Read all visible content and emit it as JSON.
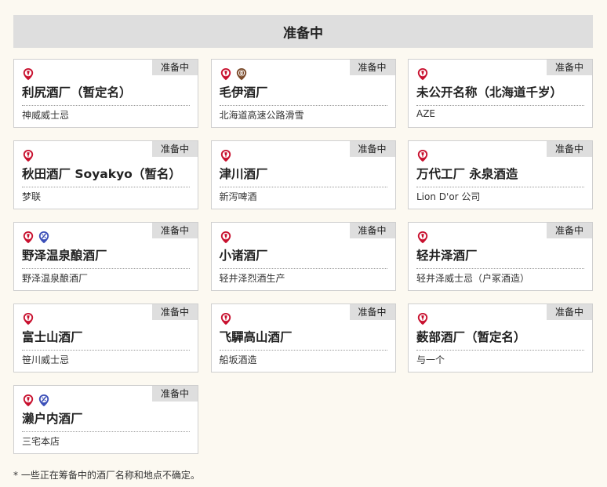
{
  "header": {
    "title": "准备中"
  },
  "cards": [
    {
      "status": "准备中",
      "name": "利尻酒厂（暂定名）",
      "brand": "神威威士忌",
      "icons": [
        "distillery-pin"
      ]
    },
    {
      "status": "准备中",
      "name": "毛伊酒厂",
      "brand": "北海道高速公路滑雪",
      "icons": [
        "distillery-pin",
        "barrel-pin"
      ]
    },
    {
      "status": "准备中",
      "name": "未公开名称（北海道千岁）",
      "brand": "AZE",
      "icons": [
        "distillery-pin"
      ]
    },
    {
      "status": "准备中",
      "name": "秋田酒厂 Soyakyo（暂名）",
      "brand": "梦联",
      "icons": [
        "distillery-pin"
      ]
    },
    {
      "status": "准备中",
      "name": "津川酒厂",
      "brand": "新泻啤酒",
      "icons": [
        "distillery-pin"
      ]
    },
    {
      "status": "准备中",
      "name": "万代工厂 永泉酒造",
      "brand": "Lion D'or 公司",
      "icons": [
        "distillery-pin"
      ]
    },
    {
      "status": "准备中",
      "name": "野泽温泉酿酒厂",
      "brand": "野泽温泉酿酒厂",
      "icons": [
        "distillery-pin",
        "blend-pin"
      ]
    },
    {
      "status": "准备中",
      "name": "小诸酒厂",
      "brand": "轻井泽烈酒生产",
      "icons": [
        "distillery-pin"
      ]
    },
    {
      "status": "准备中",
      "name": "轻井泽酒厂",
      "brand": "轻井泽威士忌（户冢酒造）",
      "icons": [
        "distillery-pin"
      ]
    },
    {
      "status": "准备中",
      "name": "富士山酒厂",
      "brand": "笹川威士忌",
      "icons": [
        "distillery-pin"
      ]
    },
    {
      "status": "准备中",
      "name": "飞驒高山酒厂",
      "brand": "船坂酒造",
      "icons": [
        "distillery-pin"
      ]
    },
    {
      "status": "准备中",
      "name": "薮部酒厂（暂定名）",
      "brand": "与一个",
      "icons": [
        "distillery-pin"
      ]
    },
    {
      "status": "准备中",
      "name": "濑户内酒厂",
      "brand": "三宅本店",
      "icons": [
        "distillery-pin",
        "blend-pin"
      ]
    }
  ],
  "footnote": "* 一些正在筹备中的酒厂名称和地点不确定。",
  "colors": {
    "distillery": "#c8102e",
    "barrel": "#7a4a2a",
    "blend": "#3b4fb8"
  }
}
